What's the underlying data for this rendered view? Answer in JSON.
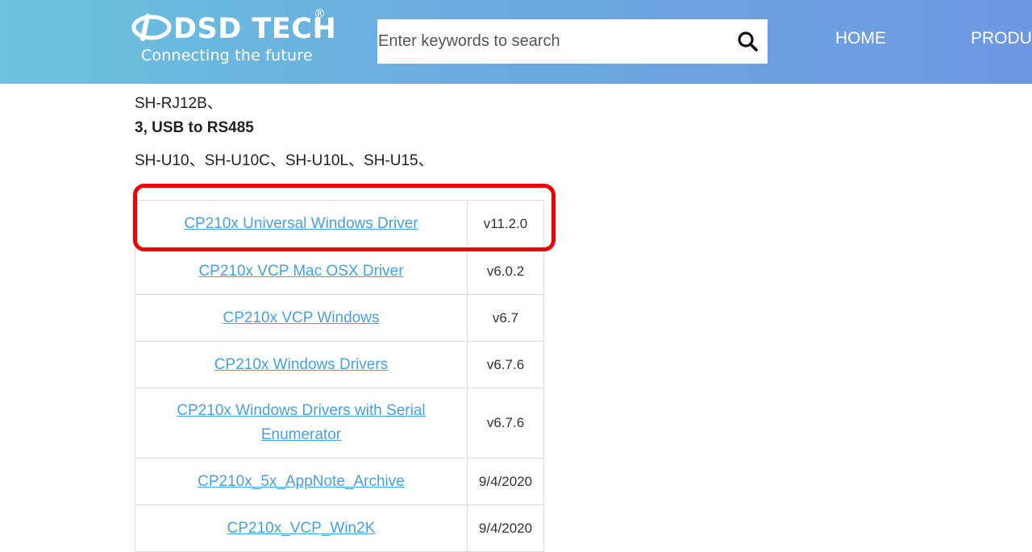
{
  "header": {
    "logo": {
      "name": "DSD TECH",
      "registered": "®",
      "tagline": "Connecting the future"
    },
    "search": {
      "placeholder": "Enter keywords to search",
      "button_icon": "search-icon"
    },
    "nav": [
      {
        "label": "HOME"
      },
      {
        "label": "PRODU"
      }
    ],
    "colors": {
      "gradient_start": "#6cc3de",
      "gradient_end": "#6e98e2"
    }
  },
  "content": {
    "lines": [
      {
        "text": "SH-RJ12B、"
      },
      {
        "text": "3, USB to RS485"
      },
      {
        "text": "SH-U10、SH-U10C、SH-U10L、SH-U15、"
      }
    ],
    "drivers": [
      {
        "name": "CP210x Universal Windows Driver",
        "version": "v11.2.0",
        "highlighted": true
      },
      {
        "name": "CP210x VCP Mac OSX Driver",
        "version": "v6.0.2"
      },
      {
        "name": "CP210x VCP Windows",
        "version": "v6.7"
      },
      {
        "name": "CP210x Windows Drivers",
        "version": "v6.7.6"
      },
      {
        "name_line1": "CP210x Windows Drivers with Serial",
        "name_line2": "Enumerator",
        "version": "v6.7.6"
      },
      {
        "name": "CP210x_5x_AppNote_Archive",
        "version": "9/4/2020"
      },
      {
        "name": "CP210x_VCP_Win2K",
        "version": "9/4/2020"
      }
    ],
    "colors": {
      "link": "#4a9fe0",
      "highlight_border": "#ee0000"
    }
  }
}
